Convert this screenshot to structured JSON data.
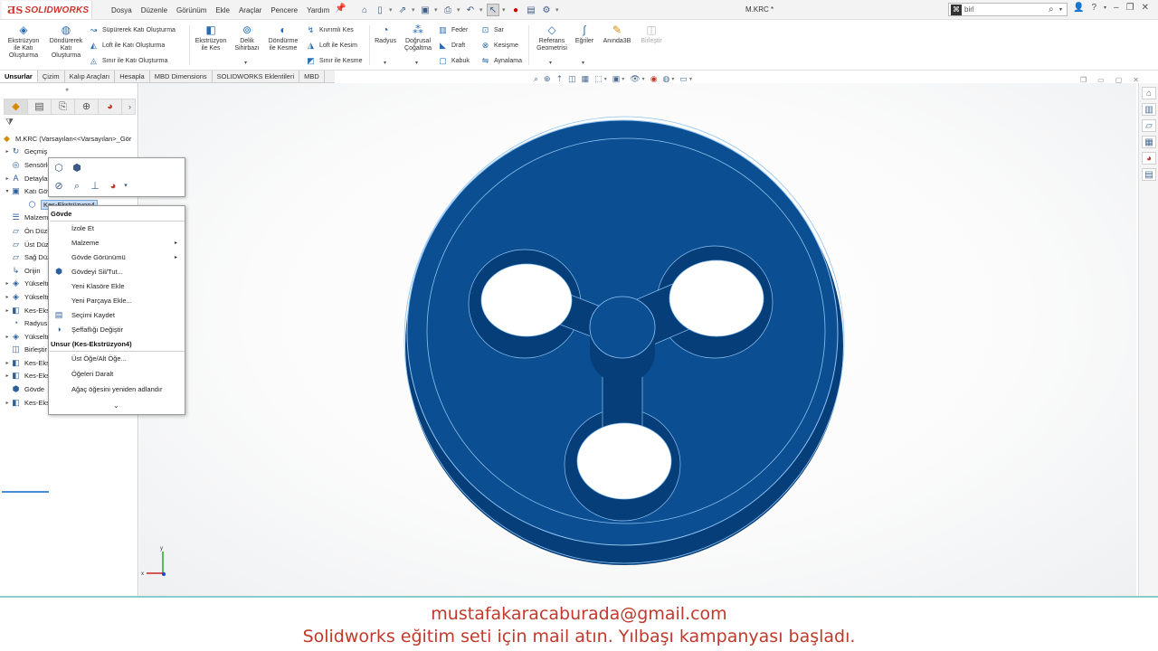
{
  "app": {
    "brand": "SOLIDWORKS",
    "document_title": "M.KRC *"
  },
  "menu": [
    "Dosya",
    "Düzenle",
    "Görünüm",
    "Ekle",
    "Araçlar",
    "Pencere",
    "Yardım"
  ],
  "search": {
    "value": "birl"
  },
  "ribbon": {
    "big_buttons": [
      "Ekstrüzyon ile Katı Oluşturma",
      "Döndürerek Katı Oluşturma",
      "Ekstrüzyon ile Kes",
      "Delik Sihirbazı",
      "Döndürme ile Kesme",
      "Radyus",
      "Doğrusal Çoğaltma",
      "Referans Geometrisi",
      "Eğriler",
      "Anında3B",
      "Birleştir"
    ],
    "small_buttons": [
      "Süpürerek Katı Oluşturma",
      "Loft ile Katı Oluşturma",
      "Sınır ile Katı Oluşturma",
      "Kıvrımlı Kes",
      "Loft ile Kesim",
      "Sınır ile Kesme",
      "Feder",
      "Draft",
      "Kabuk",
      "Sar",
      "Kesişme",
      "Aynalama"
    ]
  },
  "tabs": [
    {
      "label": "Unsurlar",
      "active": true
    },
    {
      "label": "Çizim",
      "active": false
    },
    {
      "label": "Kalıp Araçları",
      "active": false
    },
    {
      "label": "Hesapla",
      "active": false
    },
    {
      "label": "MBD Dimensions",
      "active": false
    },
    {
      "label": "SOLIDWORKS Eklentileri",
      "active": false
    },
    {
      "label": "MBD",
      "active": false
    }
  ],
  "tree": {
    "root": "M.KRC  (Varsayılan<<Varsayılan>_Gör",
    "items": [
      {
        "label": "Geçmiş",
        "icon": "history-icon",
        "expand": "▸"
      },
      {
        "label": "Sensörler",
        "icon": "sensor-icon",
        "expand": ""
      },
      {
        "label": "Detaylandırma",
        "icon": "annotation-icon",
        "expand": "▸"
      },
      {
        "label": "Katı Gövdeler",
        "icon": "folder-icon",
        "expand": "▾"
      },
      {
        "label": "Kes-Ekstrüzyon4",
        "icon": "solid-body-icon",
        "expand": "",
        "selected": true
      },
      {
        "label": "Malzeme",
        "icon": "material-icon",
        "expand": ""
      },
      {
        "label": "Ön Düzlem",
        "icon": "plane-icon",
        "expand": ""
      },
      {
        "label": "Üst Düzlem",
        "icon": "plane-icon",
        "expand": ""
      },
      {
        "label": "Sağ Düzlem",
        "icon": "plane-icon",
        "expand": ""
      },
      {
        "label": "Orijin",
        "icon": "origin-icon",
        "expand": ""
      },
      {
        "label": "Yükseltme",
        "icon": "extrude-icon",
        "expand": "▸"
      },
      {
        "label": "Yükseltme",
        "icon": "extrude-icon",
        "expand": "▸"
      },
      {
        "label": "Kes-Ekstrüzyon",
        "icon": "cut-icon",
        "expand": "▸"
      },
      {
        "label": "Radyus",
        "icon": "fillet-icon",
        "expand": ""
      },
      {
        "label": "Yükseltme",
        "icon": "extrude-icon",
        "expand": "▸"
      },
      {
        "label": "Birleştir",
        "icon": "combine-icon",
        "expand": ""
      },
      {
        "label": "Kes-Ekstrüzyon",
        "icon": "cut-icon",
        "expand": "▸"
      },
      {
        "label": "Kes-Ekstrüzyon",
        "icon": "cut-icon",
        "expand": "▸"
      },
      {
        "label": "Gövde",
        "icon": "body-icon",
        "expand": ""
      },
      {
        "label": "Kes-Ekstrüzyon",
        "icon": "cut-icon",
        "expand": "▸"
      }
    ]
  },
  "context_menu": {
    "section1": "Gövde",
    "items1": [
      {
        "label": "İzole Et",
        "submenu": false
      },
      {
        "label": "Malzeme",
        "submenu": true
      },
      {
        "label": "Gövde Görünümü",
        "submenu": true
      },
      {
        "label": "Gövdeyi Sil/Tut...",
        "submenu": false
      },
      {
        "label": "Yeni Klasöre Ekle",
        "submenu": false
      },
      {
        "label": "Yeni Parçaya Ekle...",
        "submenu": false
      },
      {
        "label": "Seçimi Kaydet",
        "submenu": false
      },
      {
        "label": "Şeffaflığı Değiştir",
        "submenu": false
      }
    ],
    "section2": "Unsur (Kes-Ekstrüzyon4)",
    "items2": [
      {
        "label": "Üst Öğe/Alt Öğe..."
      },
      {
        "label": "Öğeleri Daralt"
      },
      {
        "label": "Ağaç öğesini yeniden adlandır"
      }
    ],
    "more": "⌄"
  },
  "model": {
    "body_color": "#0b4e92",
    "side_color": "#063e7a",
    "edge_color": "#8ec3f2"
  },
  "triad": {
    "x": "x",
    "y": "y"
  },
  "caption": {
    "line1": "mustafakaracaburada@gmail.com",
    "line2": "Solidworks eğitim seti için mail atın. Yılbaşı kampanyası başladı."
  }
}
